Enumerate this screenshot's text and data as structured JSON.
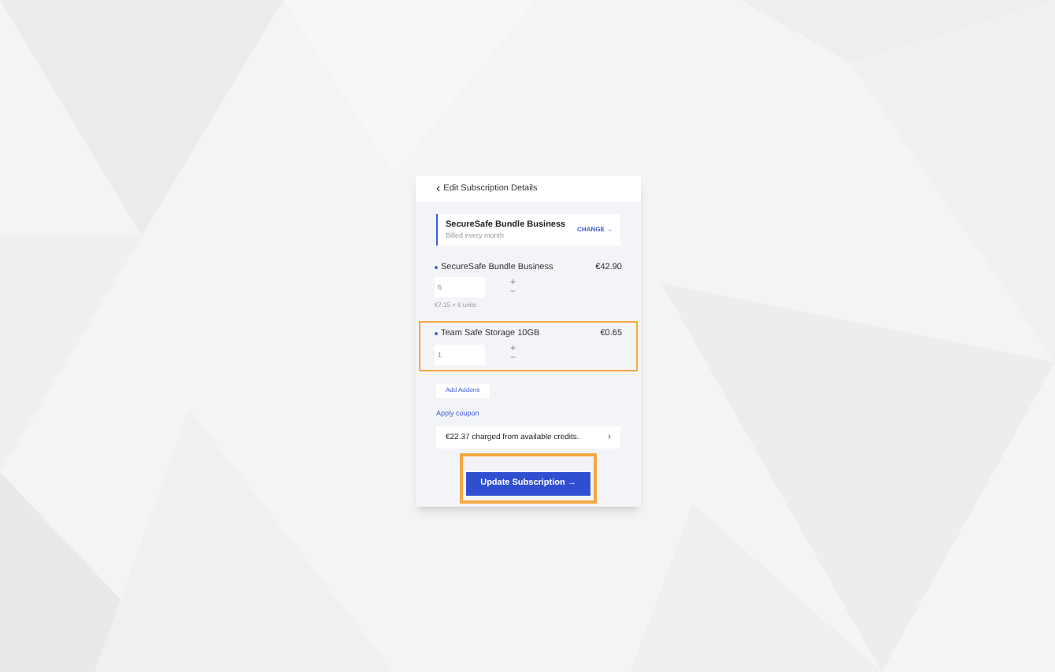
{
  "header": {
    "back_icon": "‹",
    "title": "Edit Subscription Details"
  },
  "plan": {
    "name": "SecureSafe Bundle Business",
    "billing": "Billed every month",
    "change_link": "CHANGE →"
  },
  "items": [
    {
      "name": "SecureSafe Bundle Business",
      "price": "€42.90",
      "quantity": "6",
      "plus": "+",
      "minus": "−",
      "note": "€7.15 × 6 units",
      "highlighted": false
    },
    {
      "name": "Team Safe Storage 10GB",
      "price": "€0.65",
      "quantity": "1",
      "plus": "+",
      "minus": "−",
      "highlighted": true
    }
  ],
  "add_addons": "Add Addons",
  "apply_coupon": "Apply coupon",
  "credits": {
    "text": "€22.37 charged from available credits.",
    "arrow": "›"
  },
  "submit": {
    "label": "Update Subscription →",
    "highlighted": true
  }
}
